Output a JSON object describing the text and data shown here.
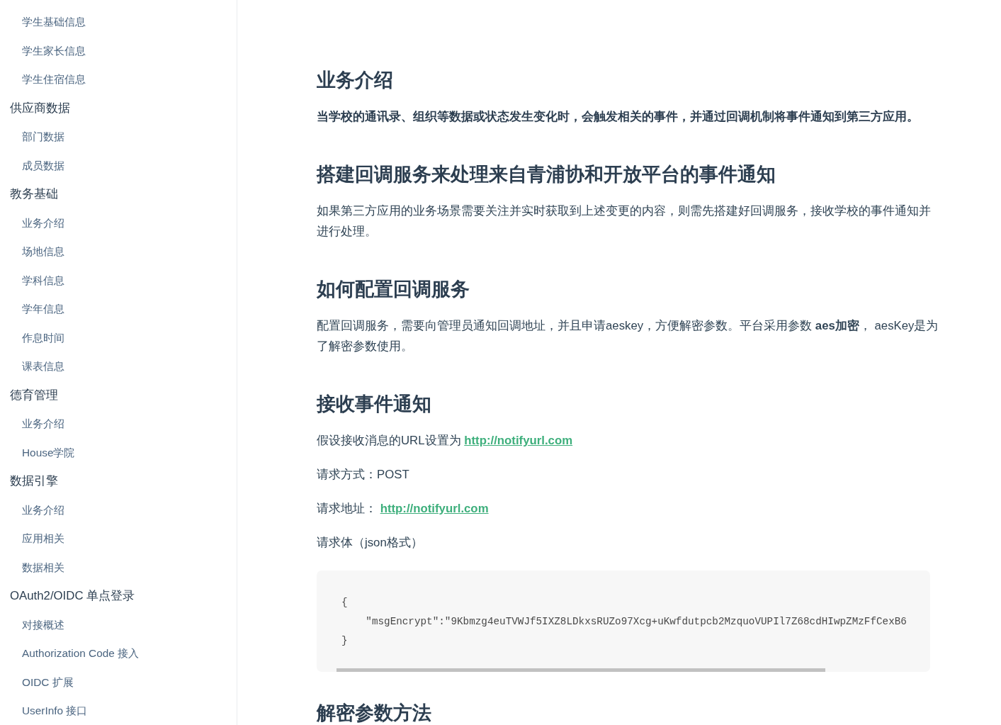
{
  "sidebar": {
    "groups": [
      {
        "children": [
          {
            "label": "学生基础信息"
          },
          {
            "label": "学生家长信息"
          },
          {
            "label": "学生住宿信息"
          }
        ]
      },
      {
        "label": "供应商数据",
        "children": [
          {
            "label": "部门数据"
          },
          {
            "label": "成员数据"
          }
        ]
      },
      {
        "label": "教务基础",
        "children": [
          {
            "label": "业务介绍"
          },
          {
            "label": "场地信息"
          },
          {
            "label": "学科信息"
          },
          {
            "label": "学年信息"
          },
          {
            "label": "作息时间"
          },
          {
            "label": "课表信息"
          }
        ]
      },
      {
        "label": "德育管理",
        "children": [
          {
            "label": "业务介绍"
          },
          {
            "label": "House学院"
          }
        ]
      },
      {
        "label": "数据引擎",
        "children": [
          {
            "label": "业务介绍"
          },
          {
            "label": "应用相关"
          },
          {
            "label": "数据相关"
          }
        ]
      },
      {
        "label": "OAuth2/OIDC 单点登录",
        "children": [
          {
            "label": "对接概述"
          },
          {
            "label": "Authorization Code 接入"
          },
          {
            "label": "OIDC 扩展"
          },
          {
            "label": "UserInfo 接口"
          }
        ]
      }
    ]
  },
  "content": [
    {
      "kind": "heading",
      "text": "业务介绍"
    },
    {
      "kind": "lead",
      "text": "当学校的通讯录、组织等数据或状态发生变化时，会触发相关的事件，并通过回调机制将事件通知到第三方应用。"
    },
    {
      "kind": "heading",
      "text": "搭建回调服务来处理来自青浦协和开放平台的事件通知"
    },
    {
      "kind": "paragraph",
      "text": "如果第三方应用的业务场景需要关注并实时获取到上述变更的内容，则需先搭建好回调服务，接收学校的事件通知并进行处理。"
    },
    {
      "kind": "heading",
      "text": "如何配置回调服务"
    },
    {
      "kind": "paragraph",
      "text": "配置回调服务，需要向管理员通知回调地址，并且申请aeskey，方便解密参数。平台采用参数 **aes加密**， aesKey是为了解密参数使用。"
    },
    {
      "kind": "heading",
      "text": "接收事件通知"
    },
    {
      "kind": "paragraph",
      "text": "假设接收消息的URL设置为",
      "link": "http://notifyurl.com"
    },
    {
      "kind": "paragraph",
      "text": "请求方式：POST"
    },
    {
      "kind": "paragraph",
      "text": "请求地址：",
      "link": "http://notifyurl.com"
    },
    {
      "kind": "paragraph",
      "text": "请求体（json格式）"
    },
    {
      "kind": "code",
      "lines": [
        "{",
        "    \"msgEncrypt\":\"9Kbmzg4euTVWJf5IXZ8LDkxsRUZo97Xcg+uKwfdutpcb2MzquoVUPIl7Z68cdHIwpZMzFfCexB6",
        "}"
      ]
    },
    {
      "kind": "heading",
      "text": "解密参数方法"
    }
  ]
}
